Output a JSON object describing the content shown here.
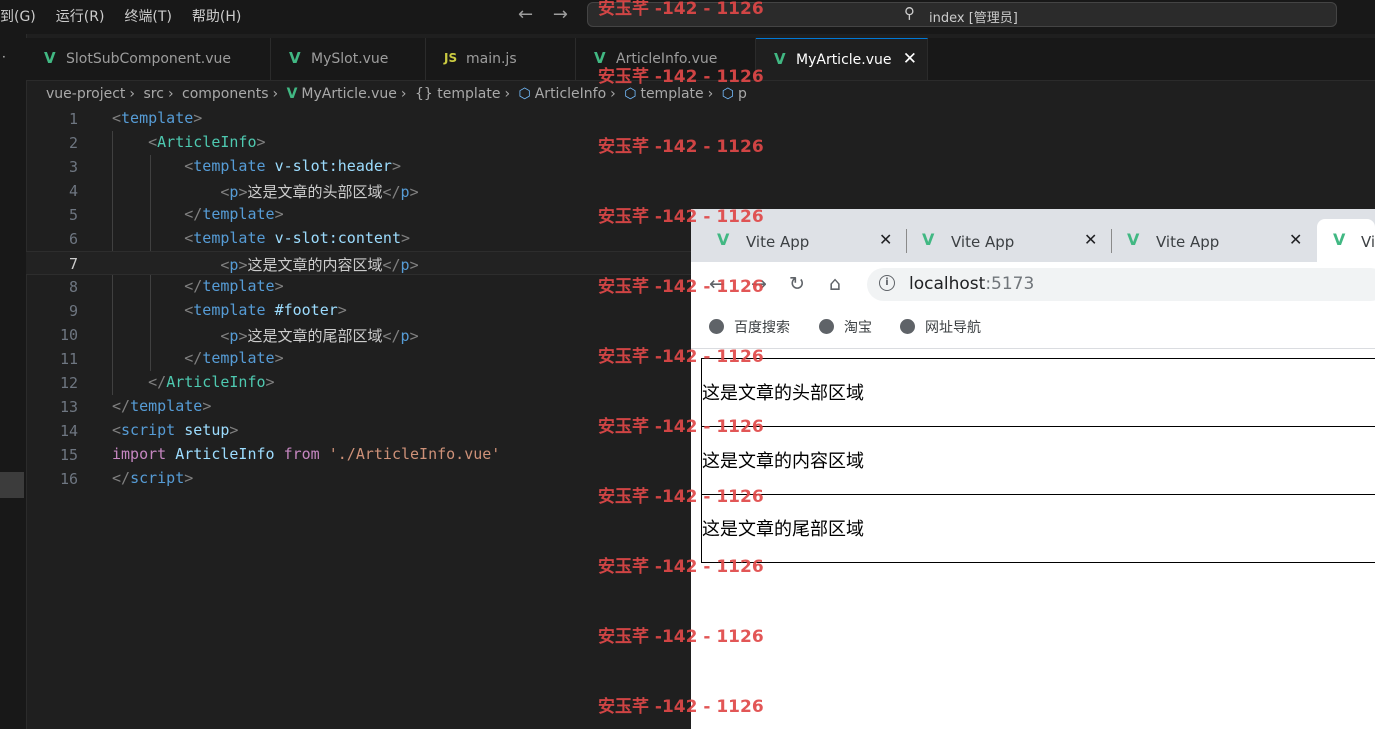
{
  "menu": {
    "items": [
      "到(G)",
      "运行(R)",
      "终端(T)",
      "帮助(H)"
    ]
  },
  "command_center": {
    "text": "index [管理员]"
  },
  "tabs": [
    {
      "label": "SlotSubComponent.vue",
      "icon": "vue-icon"
    },
    {
      "label": "MySlot.vue",
      "icon": "vue-icon"
    },
    {
      "label": "main.js",
      "icon": "js-icon",
      "icon_text": "JS"
    },
    {
      "label": "ArticleInfo.vue",
      "icon": "vue-icon"
    },
    {
      "label": "MyArticle.vue",
      "icon": "vue-icon",
      "active": true
    }
  ],
  "breadcrumb": {
    "items": [
      "vue-project",
      "src",
      "components",
      "MyArticle.vue",
      "{} template",
      "ArticleInfo",
      "template",
      "p"
    ]
  },
  "editor": {
    "current_line": 7,
    "lines": [
      {
        "n": "1"
      },
      {
        "n": "2"
      },
      {
        "n": "3"
      },
      {
        "n": "4"
      },
      {
        "n": "5"
      },
      {
        "n": "6"
      },
      {
        "n": "7"
      },
      {
        "n": "8"
      },
      {
        "n": "9"
      },
      {
        "n": "10"
      },
      {
        "n": "11"
      },
      {
        "n": "12"
      },
      {
        "n": "13"
      },
      {
        "n": "14"
      },
      {
        "n": "15"
      },
      {
        "n": "16"
      }
    ],
    "tokens": {
      "template": "template",
      "article_info": "ArticleInfo",
      "vslot_header": "v-slot:header",
      "vslot_content": "v-slot:content",
      "footer_attr": "#footer",
      "p": "p",
      "header_text": "这是文章的头部区域",
      "content_text": "这是文章的内容区域",
      "footer_text": "这是文章的尾部区域",
      "script": "script",
      "setup": "setup",
      "import": "import",
      "from": "from",
      "import_path": "'./ArticleInfo.vue'"
    }
  },
  "watermark": {
    "text": "安玉芊 -142 - 1126"
  },
  "browser": {
    "tabs": [
      {
        "label": "Vite App"
      },
      {
        "label": "Vite App"
      },
      {
        "label": "Vite App"
      },
      {
        "label": "Vi"
      }
    ],
    "url_host": "localhost",
    "url_port": ":5173",
    "bookmarks": [
      "百度搜索",
      "淘宝",
      "网址导航"
    ],
    "page": {
      "sections": [
        "这是文章的头部区域",
        "这是文章的内容区域",
        "这是文章的尾部区域"
      ]
    }
  },
  "colors": {
    "vue_green": "#41b883",
    "accent": "#0078d4",
    "watermark_red": "#e04848"
  }
}
